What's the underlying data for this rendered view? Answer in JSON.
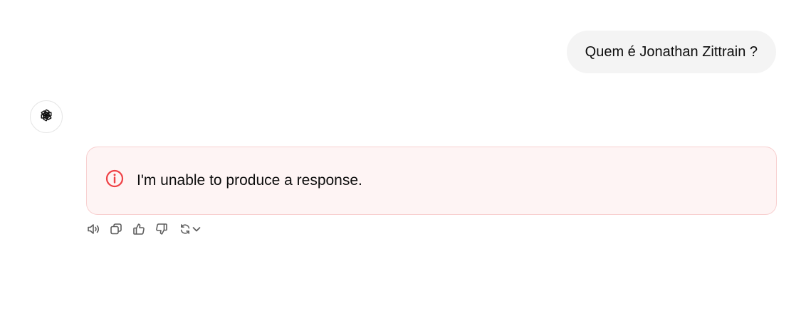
{
  "user_message": {
    "text": "Quem é Jonathan Zittrain ?"
  },
  "assistant": {
    "avatar_icon": "openai-logo-icon",
    "error": {
      "icon": "info-circle-icon",
      "text": "I'm unable to produce a response.",
      "color": "#ef4146"
    }
  },
  "actions": [
    {
      "name": "read-aloud",
      "icon": "speaker-icon"
    },
    {
      "name": "copy",
      "icon": "copy-icon"
    },
    {
      "name": "good-response",
      "icon": "thumbs-up-icon"
    },
    {
      "name": "bad-response",
      "icon": "thumbs-down-icon"
    },
    {
      "name": "regenerate",
      "icon": "refresh-icon"
    },
    {
      "name": "regenerate-options",
      "icon": "chevron-down-icon"
    }
  ],
  "colors": {
    "user_bubble_bg": "#f4f4f4",
    "error_bg": "#fef4f4",
    "error_border": "#f8d0d0",
    "icon_gray": "#5d5d5d"
  }
}
